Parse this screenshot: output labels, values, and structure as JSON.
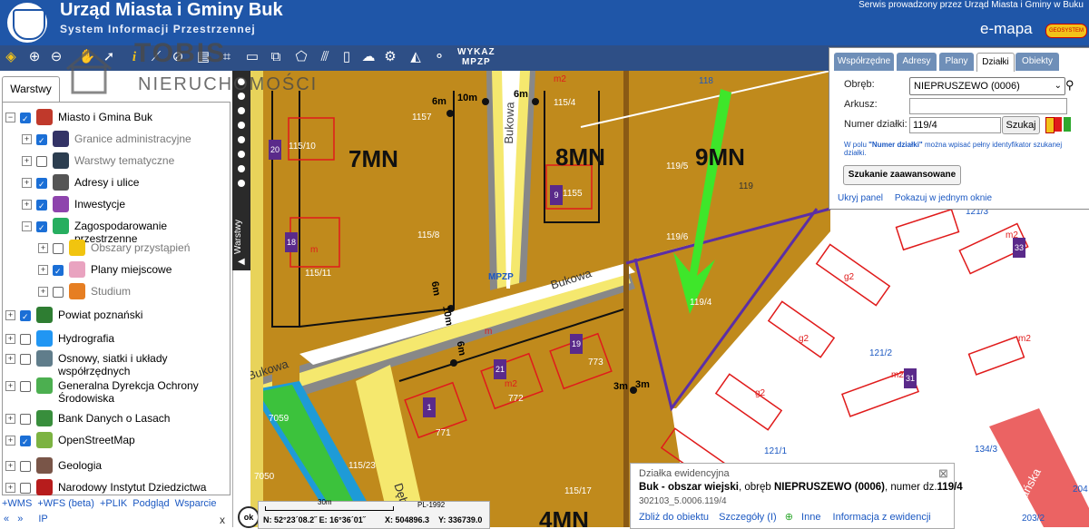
{
  "header": {
    "title": "Urząd Miasta i Gminy Buk",
    "subtitle": "System Informacji Przestrzennej",
    "service_note": "Serwis prowadzony przez Urząd Miasta i Gminy w Buku",
    "brand": "e-mapa",
    "brand_badge": "GEOSYSTEM"
  },
  "watermark": {
    "big": "TOBIS",
    "small": "NIERUCHOMOŚCI"
  },
  "toolbar": {
    "wykaz_line1": "WYKAZ",
    "wykaz_line2": "MPZP",
    "tools": [
      "layers-icon",
      "zoom-in-icon",
      "zoom-out-icon",
      "pan-icon",
      "select-arrow-icon",
      "info-icon",
      "measure-icon",
      "identify-icon",
      "print-icon",
      "crop-icon",
      "polygon-icon",
      "hatch-icon",
      "bookmark-icon",
      "link-icon",
      "cloud-icon",
      "settings-icon",
      "triangle-icon",
      "share-icon"
    ]
  },
  "left_panel": {
    "tab_label": "Warstwy",
    "side_label": "Warstwy",
    "tree": [
      {
        "label": "Miasto i Gmina Buk",
        "checked": true,
        "expanded": true,
        "indent": 0,
        "grey": false,
        "icon_color": "#c0392b"
      },
      {
        "label": "Granice administracyjne",
        "checked": true,
        "expanded": false,
        "indent": 1,
        "grey": true,
        "icon_color": "#333366"
      },
      {
        "label": "Warstwy tematyczne",
        "checked": false,
        "expanded": false,
        "indent": 1,
        "grey": true,
        "icon_color": "#2c3e50"
      },
      {
        "label": "Adresy i ulice",
        "checked": true,
        "expanded": false,
        "indent": 1,
        "grey": false,
        "icon_color": "#555555"
      },
      {
        "label": "Inwestycje",
        "checked": true,
        "expanded": false,
        "indent": 1,
        "grey": false,
        "icon_color": "#8e44ad"
      },
      {
        "label": "Zagospodarowanie przestrzenne",
        "checked": true,
        "expanded": true,
        "indent": 1,
        "grey": false,
        "icon_color": "#27ae60"
      },
      {
        "label": "Obszary przystąpień",
        "checked": false,
        "expanded": false,
        "indent": 2,
        "grey": true,
        "icon_color": "#f1c40f"
      },
      {
        "label": "Plany miejscowe",
        "checked": true,
        "expanded": false,
        "indent": 2,
        "grey": false,
        "icon_color": "#e9a3c0"
      },
      {
        "label": "Studium",
        "checked": false,
        "expanded": false,
        "indent": 2,
        "grey": true,
        "icon_color": "#e67e22"
      },
      {
        "label": "Powiat poznański",
        "checked": true,
        "expanded": false,
        "indent": 0,
        "grey": false,
        "icon_color": "#2e7d32"
      },
      {
        "label": "Hydrografia",
        "checked": false,
        "expanded": false,
        "indent": 0,
        "grey": false,
        "icon_color": "#2196f3"
      },
      {
        "label": "Osnowy, siatki i układy współrzędnych",
        "checked": false,
        "expanded": false,
        "indent": 0,
        "grey": false,
        "icon_color": "#607d8b"
      },
      {
        "label": "Generalna Dyrekcja Ochrony Środowiska",
        "checked": false,
        "expanded": false,
        "indent": 0,
        "grey": false,
        "icon_color": "#4caf50"
      },
      {
        "label": "Bank Danych o Lasach",
        "checked": false,
        "expanded": false,
        "indent": 0,
        "grey": false,
        "icon_color": "#388e3c"
      },
      {
        "label": "OpenStreetMap",
        "checked": true,
        "expanded": false,
        "indent": 0,
        "grey": false,
        "icon_color": "#7cb342"
      },
      {
        "label": "Geologia",
        "checked": false,
        "expanded": false,
        "indent": 0,
        "grey": false,
        "icon_color": "#795548"
      },
      {
        "label": "Narodowy Instytut Dziedzictwa",
        "checked": false,
        "expanded": false,
        "indent": 0,
        "grey": false,
        "icon_color": "#b71c1c"
      }
    ],
    "bottom_links": [
      "+WMS",
      "+WFS (beta)",
      "+PLIK",
      "Podgląd",
      "Wsparcie"
    ],
    "nav_prev": "«",
    "nav_next": "»",
    "nav_ip": "IP",
    "close": "x"
  },
  "map": {
    "zone_labels": [
      "7MN",
      "8MN",
      "9MN",
      "4MN"
    ],
    "street_labels": [
      "Bukowa",
      "Bukowa",
      "Dębowa",
      "Bukowa",
      "Poznańska"
    ],
    "distance_labels": [
      "6m",
      "10m",
      "6m",
      "6m",
      "10m",
      "6m",
      "3m",
      "3m"
    ],
    "parcel_labels": [
      "1157",
      "115/4",
      "115/10",
      "119/5",
      "1155",
      "115/8",
      "119/6",
      "115/11",
      "119/4",
      "773",
      "772",
      "771",
      "7059",
      "7050",
      "115/23",
      "115/17",
      "118",
      "119",
      "121/3",
      "121/2",
      "121/1",
      "134/3",
      "204",
      "203/2",
      "MPZP"
    ],
    "marker_labels": [
      "m2",
      "m",
      "m",
      "m2",
      "m2",
      "g2",
      "g2",
      "g2",
      "m2",
      "m2"
    ],
    "badges": [
      "20",
      "9",
      "18",
      "19",
      "21",
      "1",
      "33",
      "31"
    ],
    "line_color_boundary": "#5b2ea6",
    "arrow_color": "#3ee62a",
    "plot_color": "#c08a1c",
    "road_color": "#f5e86e"
  },
  "search_panel": {
    "tabs": [
      "Współrzędne",
      "Adresy",
      "Plany",
      "Działki",
      "Obiekty"
    ],
    "active_tab": "Działki",
    "obreb_label": "Obręb:",
    "obreb_value": "NIEPRUSZEWO (0006)",
    "arkusz_label": "Arkusz:",
    "arkusz_value": "",
    "numer_label": "Numer działki:",
    "numer_value": "119/4",
    "search_button": "Szukaj",
    "hint_prefix": "W polu ",
    "hint_bold": "\"Numer działki\"",
    "hint_rest": " można wpisać pełny identyfikator szukanej działki.",
    "advanced_button": "Szukanie zaawansowane",
    "hide_link": "Ukryj panel",
    "show_link": "Pokazuj w jednym oknie"
  },
  "info_box": {
    "heading": "Działka ewidencyjna",
    "line_bold1": "Buk - obszar wiejski",
    "line_mid": ", obręb ",
    "line_bold2": "NIEPRUSZEWO (0006)",
    "line_mid2": ", numer dz.",
    "line_bold3": "119/4",
    "identifier": "302103_5.0006.119/4",
    "links": [
      "Zbliż do obiektu",
      "Szczegóły (I)",
      "Inne",
      "Informacja z ewidencji"
    ]
  },
  "status": {
    "ok": "ok",
    "scale_label": "30m",
    "crs": "PL-1992",
    "coords_geo": "N: 52°23´08.2˝  E: 16°36´01˝",
    "x": "X: 504896.3",
    "y": "Y: 336739.0"
  }
}
